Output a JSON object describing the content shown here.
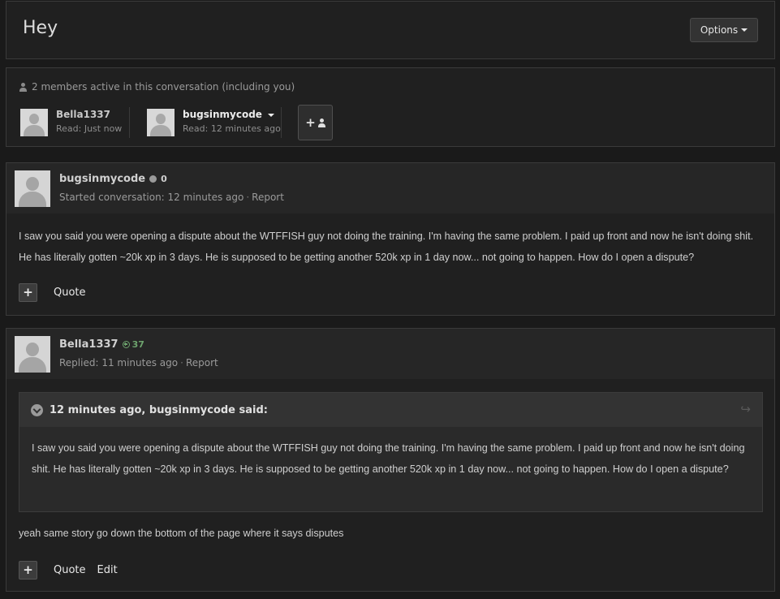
{
  "header": {
    "title": "Hey",
    "options_label": "Options"
  },
  "members": {
    "summary": "2 members active in this conversation (including you)",
    "list": [
      {
        "name": "Bella1337",
        "read": "Read: Just now"
      },
      {
        "name": "bugsinmycode",
        "read": "Read: 12 minutes ago"
      }
    ],
    "add_icon": "plus-user-icon"
  },
  "posts": [
    {
      "author": "bugsinmycode",
      "reputation": "0",
      "meta": "Started conversation: 12 minutes ago",
      "report": "Report",
      "body": "I saw you said you were opening a dispute about the WTFFISH guy not doing the training. I'm having the same problem. I paid up front and now he isn't doing shit. He has literally gotten ~20k xp in 3 days. He is supposed to be getting another 520k xp in 1 day now... not going to happen. How do I open a dispute?",
      "actions": {
        "plus": "+",
        "quote": "Quote"
      }
    },
    {
      "author": "Bella1337",
      "reputation": "37",
      "meta": "Replied: 11 minutes ago",
      "report": "Report",
      "quote_title": "12 minutes ago, bugsinmycode said:",
      "quote_body": "I saw you said you were opening a dispute about the WTFFISH guy not doing the training. I'm having the same problem. I paid up front and now he isn't doing shit. He has literally gotten ~20k xp in 3 days. He is supposed to be getting another 520k xp in 1 day now... not going to happen. How do I open a dispute?",
      "body": "yeah same story go down the bottom of the page where it says disputes",
      "actions": {
        "plus": "+",
        "quote": "Quote",
        "edit": "Edit"
      }
    }
  ]
}
